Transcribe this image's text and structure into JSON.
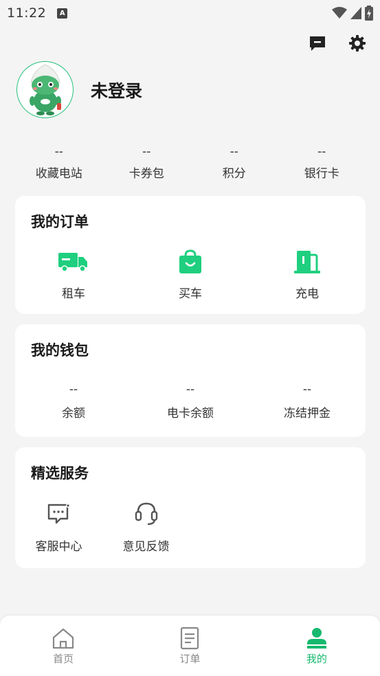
{
  "status_bar": {
    "time": "11:22",
    "a_badge": "A"
  },
  "header": {
    "icons": [
      "message-icon",
      "gear-icon"
    ]
  },
  "profile": {
    "name": "未登录",
    "avatar": "mascot-avatar"
  },
  "stats": [
    {
      "value": "--",
      "label": "收藏电站"
    },
    {
      "value": "--",
      "label": "卡券包"
    },
    {
      "value": "--",
      "label": "积分"
    },
    {
      "value": "--",
      "label": "银行卡"
    }
  ],
  "orders": {
    "title": "我的订单",
    "items": [
      {
        "label": "租车",
        "icon": "truck-icon"
      },
      {
        "label": "买车",
        "icon": "shopping-bag-icon"
      },
      {
        "label": "充电",
        "icon": "charging-station-icon"
      }
    ]
  },
  "wallet": {
    "title": "我的钱包",
    "items": [
      {
        "value": "--",
        "label": "余额"
      },
      {
        "value": "--",
        "label": "电卡余额"
      },
      {
        "value": "--",
        "label": "冻结押金"
      }
    ]
  },
  "services": {
    "title": "精选服务",
    "items": [
      {
        "label": "客服中心",
        "icon": "chat-support-icon"
      },
      {
        "label": "意见反馈",
        "icon": "headset-icon"
      }
    ]
  },
  "tabs": [
    {
      "label": "首页",
      "icon": "home-icon",
      "active": false
    },
    {
      "label": "订单",
      "icon": "document-icon",
      "active": false
    },
    {
      "label": "我的",
      "icon": "user-icon",
      "active": true
    }
  ],
  "colors": {
    "accent": "#16b96e",
    "icon_green": "#1fcf7f",
    "background": "#f4f4f4"
  }
}
